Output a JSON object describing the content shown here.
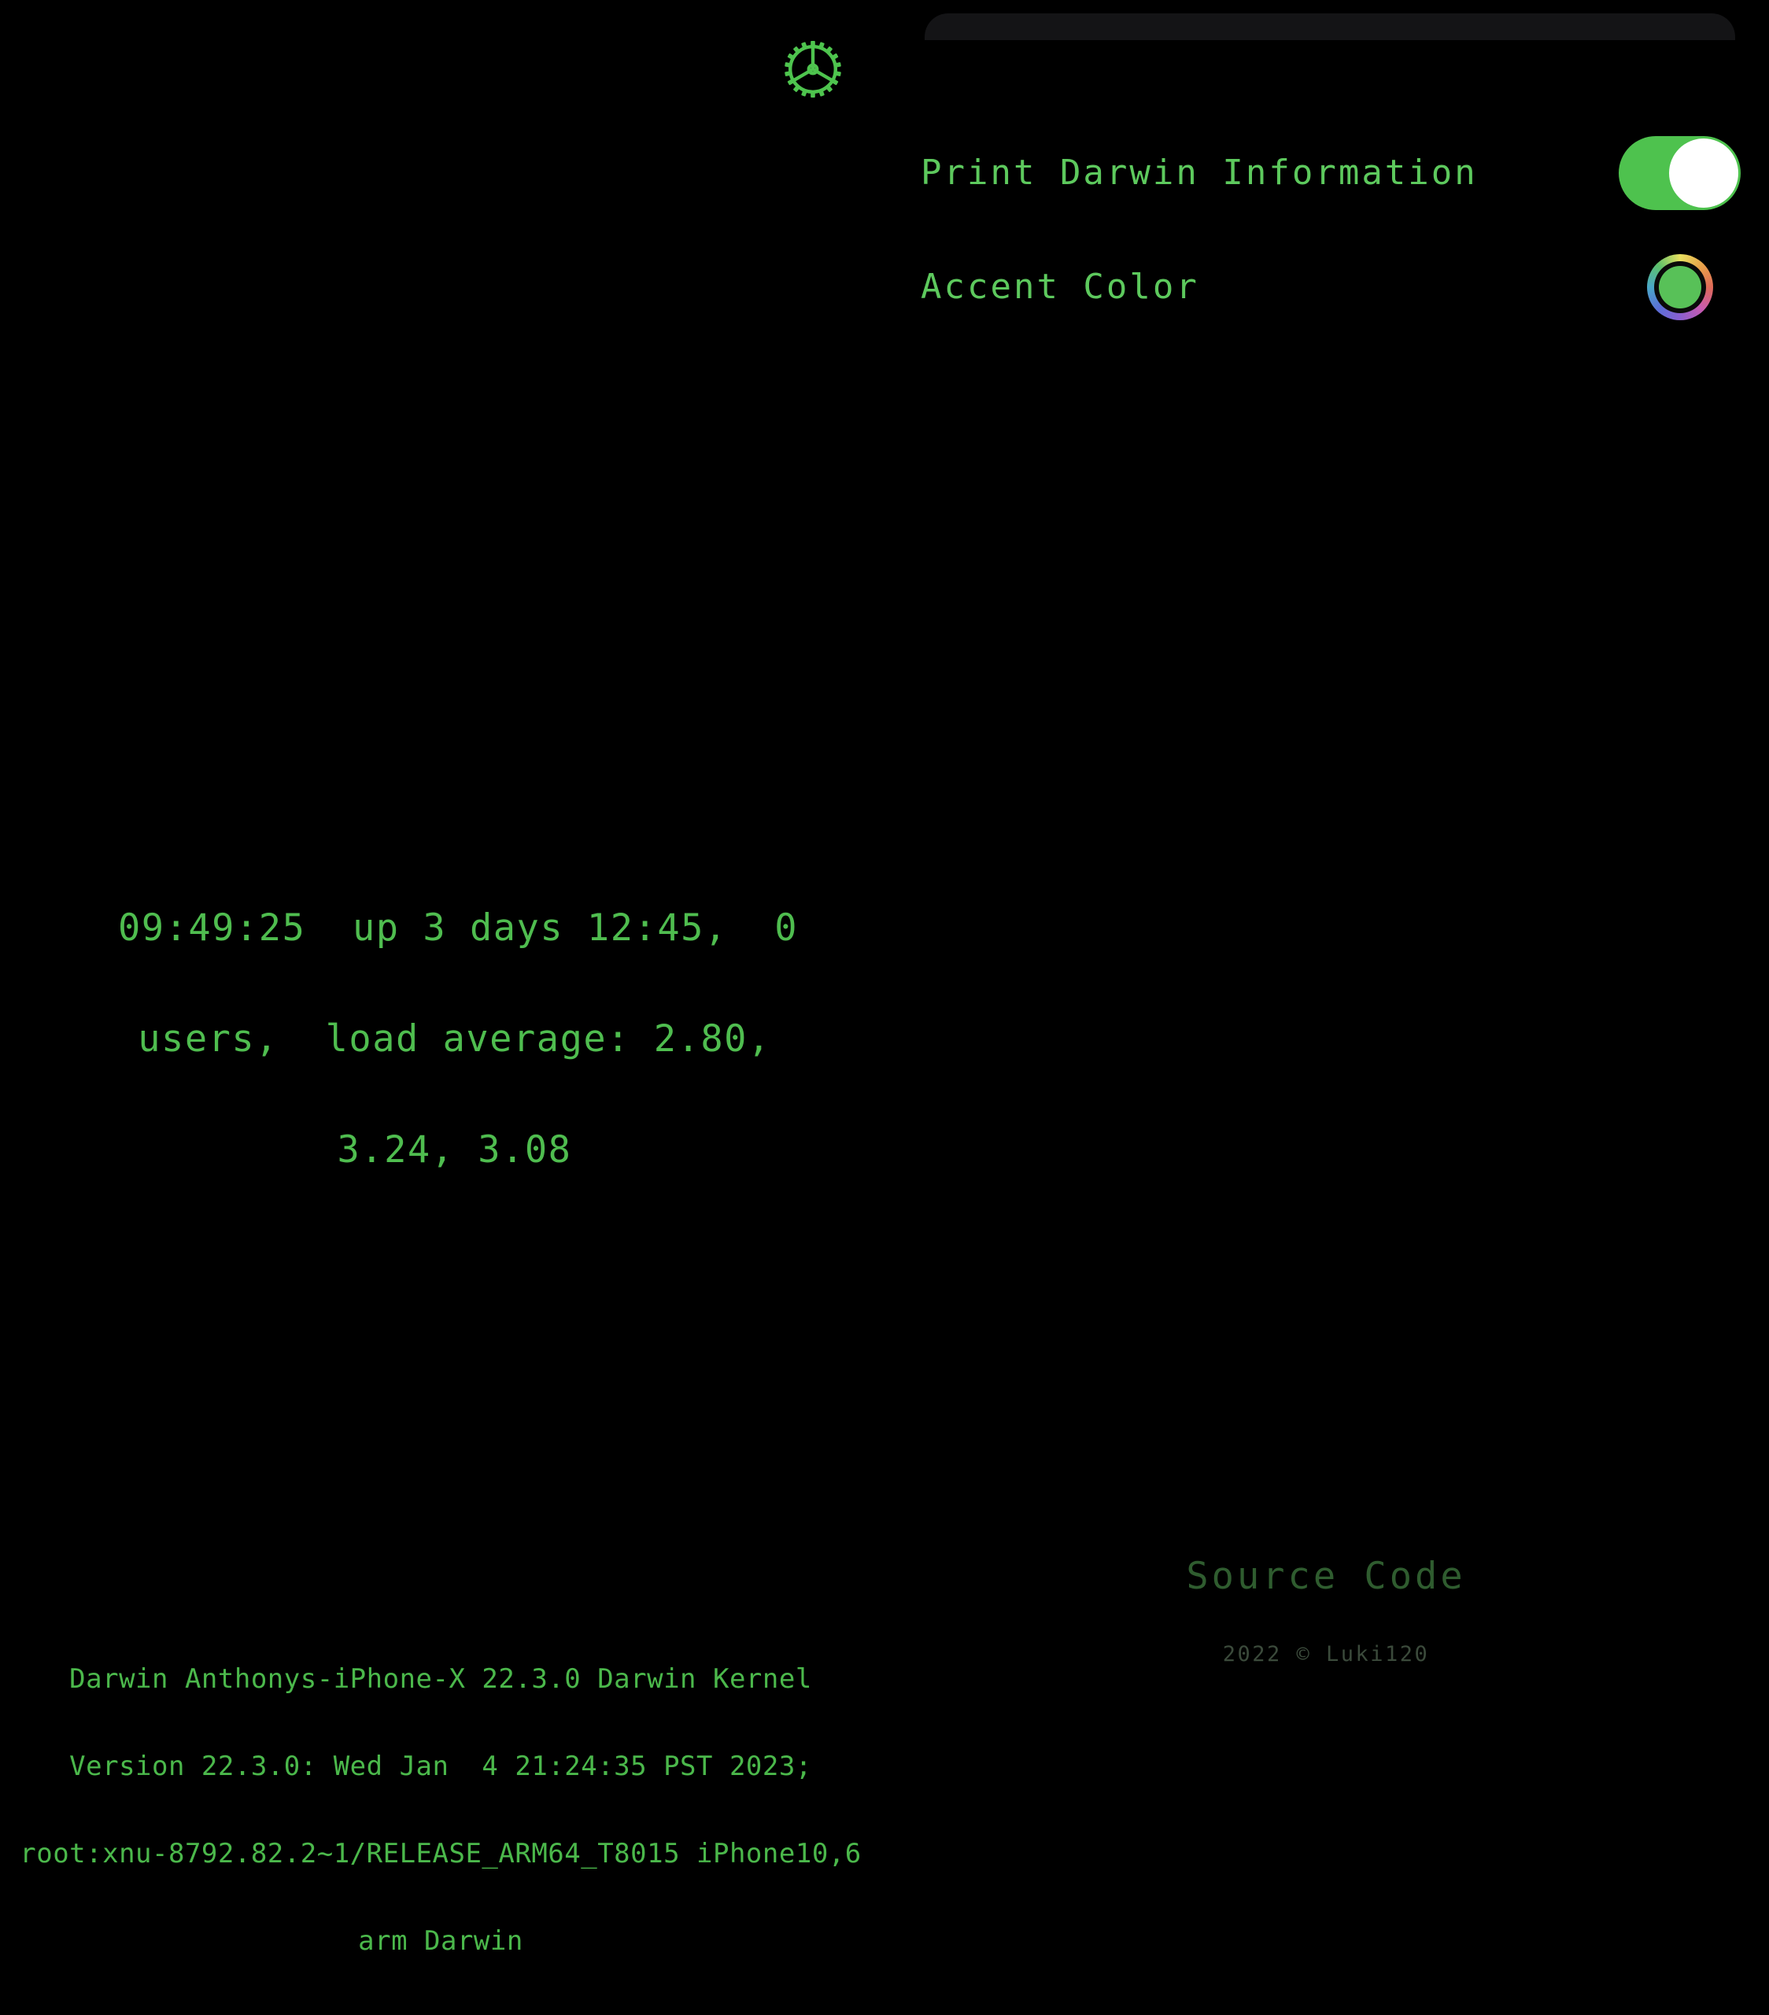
{
  "theme": {
    "background": "#000000",
    "accent_green": "#58c158",
    "text_green": "#5dc95d",
    "uptime_green": "#4fbd4f",
    "kernel_green": "#4bb84b",
    "link_green": "#2f5c2f",
    "copyright_green": "#3b4a3b",
    "sheet_background": "#141416",
    "toggle_on_color": "#4ec24e",
    "toggle_knob_color": "#ffffff"
  },
  "toolbar": {
    "settings_icon": "gear-icon"
  },
  "settings": {
    "rows": [
      {
        "label": "Print Darwin Information",
        "control": "toggle",
        "value": "on"
      },
      {
        "label": "Accent Color",
        "control": "color-well",
        "value": "#58c158"
      }
    ]
  },
  "uptime": {
    "lines": [
      "09:49:25  up 3 days 12:45,  0",
      "users,  load average: 2.80,",
      "3.24, 3.08"
    ],
    "full_text": "09:49:25  up 3 days 12:45,  0 users,  load average: 2.80, 3.24, 3.08",
    "clock": "09:49:25",
    "up_days": "3 days 12:45",
    "users": "0",
    "load_average": [
      "2.80",
      "3.24",
      "3.08"
    ]
  },
  "kernel": {
    "lines": [
      "Darwin Anthonys-iPhone-X 22.3.0 Darwin Kernel",
      "Version 22.3.0: Wed Jan  4 21:24:35 PST 2023;",
      "root:xnu-8792.82.2~1/RELEASE_ARM64_T8015 iPhone10,6",
      "arm Darwin"
    ],
    "hostname": "Anthonys-iPhone-X",
    "version": "22.3.0",
    "build_date": "Wed Jan  4 21:24:35 PST 2023",
    "xnu": "root:xnu-8792.82.2~1/RELEASE_ARM64_T8015",
    "device": "iPhone10,6",
    "arch": "arm"
  },
  "footer": {
    "source_code_label": "Source Code",
    "copyright": "2022 © Luki120"
  }
}
